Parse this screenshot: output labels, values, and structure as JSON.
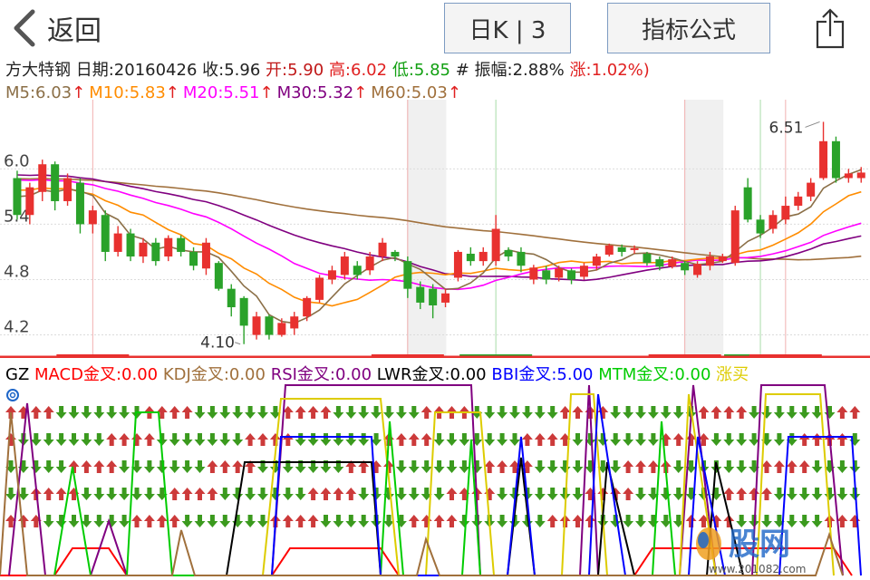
{
  "header": {
    "back_label": "返回",
    "period_label": "日K | 3",
    "formula_label": "指标公式",
    "back_icon": "chevron-left-icon",
    "share_icon": "share-icon"
  },
  "stock": {
    "name": "方大特钢",
    "date": "日期:20160426",
    "close": "收:5.96",
    "open": "开:5.90",
    "high": "高:6.02",
    "low": "低:5.85",
    "amp": "# 振幅:2.88%",
    "chg": "涨:1.02%)"
  },
  "ma_legend": [
    {
      "label": "M5:6.03",
      "color": "#8b6f47"
    },
    {
      "label": "M10:5.83",
      "color": "#ff8c00"
    },
    {
      "label": "M20:5.51",
      "color": "#ff00ff"
    },
    {
      "label": "M30:5.32",
      "color": "#800080"
    },
    {
      "label": "M60:5.03",
      "color": "#a0703c"
    }
  ],
  "gz_legend": [
    {
      "label": "GZ ",
      "color": "#000000"
    },
    {
      "label": "MACD金叉:0.00",
      "color": "#ff0000"
    },
    {
      "label": "KDJ金叉:0.00",
      "color": "#a0703c"
    },
    {
      "label": "RSI金叉:0.00",
      "color": "#800080"
    },
    {
      "label": "LWR金叉:0.00",
      "color": "#000000"
    },
    {
      "label": "BBI金叉:5.00",
      "color": "#0000ff"
    },
    {
      "label": "MTM金叉:0.00",
      "color": "#00cc00"
    },
    {
      "label": "涨买",
      "color": "#ddcc00"
    }
  ],
  "watermark": {
    "text": "www.201082.com",
    "logo": "股网"
  },
  "colors": {
    "up": "#e8312f",
    "down": "#2aa22a",
    "grid": "#e0e0e0"
  },
  "chart_data": {
    "type": "candlestick",
    "y_ticks": [
      "6.0",
      "5.4",
      "4.8",
      "4.2"
    ],
    "ylim": [
      3.95,
      6.75
    ],
    "annotations": [
      {
        "text": "6.51",
        "index": 64,
        "value": 6.51
      },
      {
        "text": "4.10",
        "index": 18,
        "value": 4.1
      }
    ],
    "candles": [
      [
        5.9,
        5.5,
        5.98,
        5.45
      ],
      [
        5.5,
        5.8,
        5.85,
        5.4
      ],
      [
        5.75,
        6.05,
        6.1,
        5.65
      ],
      [
        6.05,
        5.65,
        6.08,
        5.55
      ],
      [
        5.65,
        5.9,
        5.95,
        5.6
      ],
      [
        5.85,
        5.4,
        5.9,
        5.3
      ],
      [
        5.4,
        5.55,
        5.6,
        5.3
      ],
      [
        5.5,
        5.1,
        5.55,
        5.0
      ],
      [
        5.1,
        5.3,
        5.38,
        5.05
      ],
      [
        5.3,
        5.05,
        5.35,
        5.0
      ],
      [
        5.05,
        5.2,
        5.25,
        4.98
      ],
      [
        5.2,
        5.0,
        5.25,
        4.95
      ],
      [
        5.05,
        5.25,
        5.28,
        5.0
      ],
      [
        5.25,
        5.1,
        5.28,
        5.05
      ],
      [
        5.1,
        4.95,
        5.15,
        4.9
      ],
      [
        4.92,
        5.2,
        5.25,
        4.85
      ],
      [
        4.98,
        4.7,
        5.0,
        4.68
      ],
      [
        4.7,
        4.5,
        4.75,
        4.4
      ],
      [
        4.6,
        4.3,
        4.62,
        4.1
      ],
      [
        4.2,
        4.4,
        4.45,
        4.15
      ],
      [
        4.4,
        4.2,
        4.42,
        4.15
      ],
      [
        4.2,
        4.33,
        4.38,
        4.18
      ],
      [
        4.27,
        4.4,
        4.45,
        4.2
      ],
      [
        4.4,
        4.6,
        4.62,
        4.35
      ],
      [
        4.58,
        4.82,
        4.85,
        4.55
      ],
      [
        4.8,
        4.9,
        4.95,
        4.75
      ],
      [
        4.85,
        5.05,
        5.1,
        4.8
      ],
      [
        4.95,
        4.85,
        5.0,
        4.8
      ],
      [
        4.9,
        5.05,
        5.1,
        4.85
      ],
      [
        5.05,
        5.2,
        5.25,
        5.0
      ],
      [
        5.1,
        5.05,
        5.12,
        5.0
      ],
      [
        5.0,
        4.7,
        5.05,
        4.6
      ],
      [
        4.72,
        4.55,
        4.78,
        4.48
      ],
      [
        4.7,
        4.52,
        4.75,
        4.38
      ],
      [
        4.55,
        4.65,
        4.7,
        4.5
      ],
      [
        4.82,
        5.1,
        5.12,
        4.78
      ],
      [
        5.08,
        5.0,
        5.15,
        4.95
      ],
      [
        5.0,
        5.1,
        5.15,
        4.95
      ],
      [
        5.0,
        5.35,
        5.5,
        4.95
      ],
      [
        5.12,
        5.05,
        5.15,
        5.0
      ],
      [
        5.1,
        4.95,
        5.15,
        4.88
      ],
      [
        4.8,
        4.93,
        4.96,
        4.75
      ],
      [
        4.9,
        4.8,
        4.95,
        4.75
      ],
      [
        4.82,
        4.92,
        4.95,
        4.78
      ],
      [
        4.9,
        4.8,
        4.92,
        4.75
      ],
      [
        4.83,
        4.95,
        4.98,
        4.8
      ],
      [
        4.95,
        5.05,
        5.08,
        4.9
      ],
      [
        5.07,
        5.17,
        5.19,
        5.05
      ],
      [
        5.15,
        5.1,
        5.18,
        5.05
      ],
      [
        5.12,
        5.14,
        5.17,
        5.08
      ],
      [
        5.08,
        4.98,
        5.1,
        4.95
      ],
      [
        5.02,
        4.94,
        5.05,
        4.9
      ],
      [
        4.94,
        5.02,
        5.05,
        4.92
      ],
      [
        4.98,
        4.9,
        5.0,
        4.85
      ],
      [
        4.85,
        4.97,
        5.0,
        4.82
      ],
      [
        4.95,
        5.05,
        5.1,
        4.9
      ],
      [
        5.0,
        5.05,
        5.08,
        4.98
      ],
      [
        4.98,
        5.55,
        5.6,
        4.95
      ],
      [
        5.8,
        5.45,
        5.9,
        5.42
      ],
      [
        5.45,
        5.3,
        5.5,
        5.25
      ],
      [
        5.35,
        5.5,
        5.55,
        5.3
      ],
      [
        5.45,
        5.6,
        5.7,
        5.4
      ],
      [
        5.6,
        5.7,
        5.75,
        5.55
      ],
      [
        5.7,
        5.85,
        5.9,
        5.65
      ],
      [
        5.9,
        6.3,
        6.51,
        5.88
      ],
      [
        6.3,
        5.9,
        6.35,
        5.85
      ],
      [
        5.9,
        5.95,
        6.0,
        5.85
      ],
      [
        5.9,
        5.96,
        6.02,
        5.85
      ]
    ],
    "x_flags": [
      {
        "index": 5,
        "tone": "red"
      },
      {
        "index": 30,
        "tone": "red"
      },
      {
        "index": 37,
        "tone": "green"
      },
      {
        "index": 52,
        "tone": "red"
      },
      {
        "index": 58,
        "tone": "green"
      },
      {
        "index": 60,
        "tone": "red"
      }
    ]
  }
}
